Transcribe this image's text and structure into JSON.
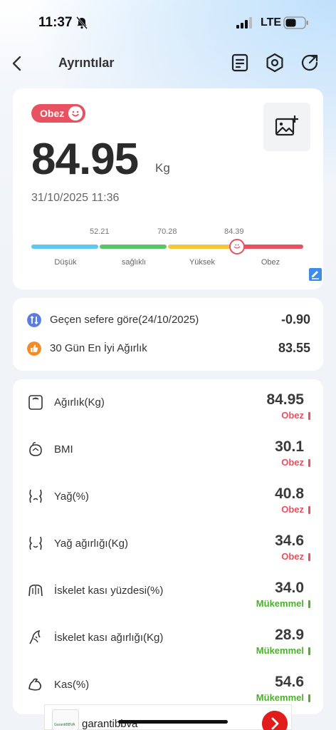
{
  "status_bar": {
    "time": "11:37",
    "network": "LTE"
  },
  "nav": {
    "title": "Ayrıntılar"
  },
  "summary": {
    "badge": "Obez",
    "weight": "84.95",
    "unit": "Kg",
    "datetime": "31/10/2025 11:36",
    "scale": {
      "thresholds": [
        "52.21",
        "70.28",
        "84.39"
      ],
      "segments": [
        "Düşük",
        "sağlıklı",
        "Yüksek",
        "Obez"
      ],
      "colors": [
        "#5ec8f0",
        "#5cc46a",
        "#f4c83a",
        "#e8515f"
      ]
    }
  },
  "comparison": [
    {
      "label": "Geçen sefere göre(24/10/2025)",
      "value": "-0.90",
      "icon": "compare-icon",
      "color": "#5a7de0"
    },
    {
      "label": "30 Gün En İyi Ağırlık",
      "value": "83.55",
      "icon": "thumbs-up-icon",
      "color": "#f28c28"
    }
  ],
  "metrics": [
    {
      "label": "Ağırlık(Kg)",
      "value": "84.95",
      "status": "Obez",
      "icon": "weight-icon",
      "color": "#e8515f"
    },
    {
      "label": "BMI",
      "value": "30.1",
      "status": "Obez",
      "icon": "bmi-icon",
      "color": "#e8515f"
    },
    {
      "label": "Yağ(%)",
      "value": "40.8",
      "status": "Obez",
      "icon": "fat-icon",
      "color": "#e8515f"
    },
    {
      "label": "Yağ ağırlığı(Kg)",
      "value": "34.6",
      "status": "Obez",
      "icon": "fat-weight-icon",
      "color": "#e8515f"
    },
    {
      "label": "İskelet kası yüzdesi(%)",
      "value": "34.0",
      "status": "Mükemmel",
      "icon": "skeletal-muscle-icon",
      "color": "#4caf2e"
    },
    {
      "label": "İskelet kası ağırlığı(Kg)",
      "value": "28.9",
      "status": "Mükemmel",
      "icon": "skeletal-weight-icon",
      "color": "#4caf2e"
    },
    {
      "label": "Kas(%)",
      "value": "54.6",
      "status": "Mükemmel",
      "icon": "muscle-icon",
      "color": "#4caf2e"
    }
  ],
  "ad": {
    "text": "garantibbva",
    "logo_text": "GarantiBBVA"
  }
}
